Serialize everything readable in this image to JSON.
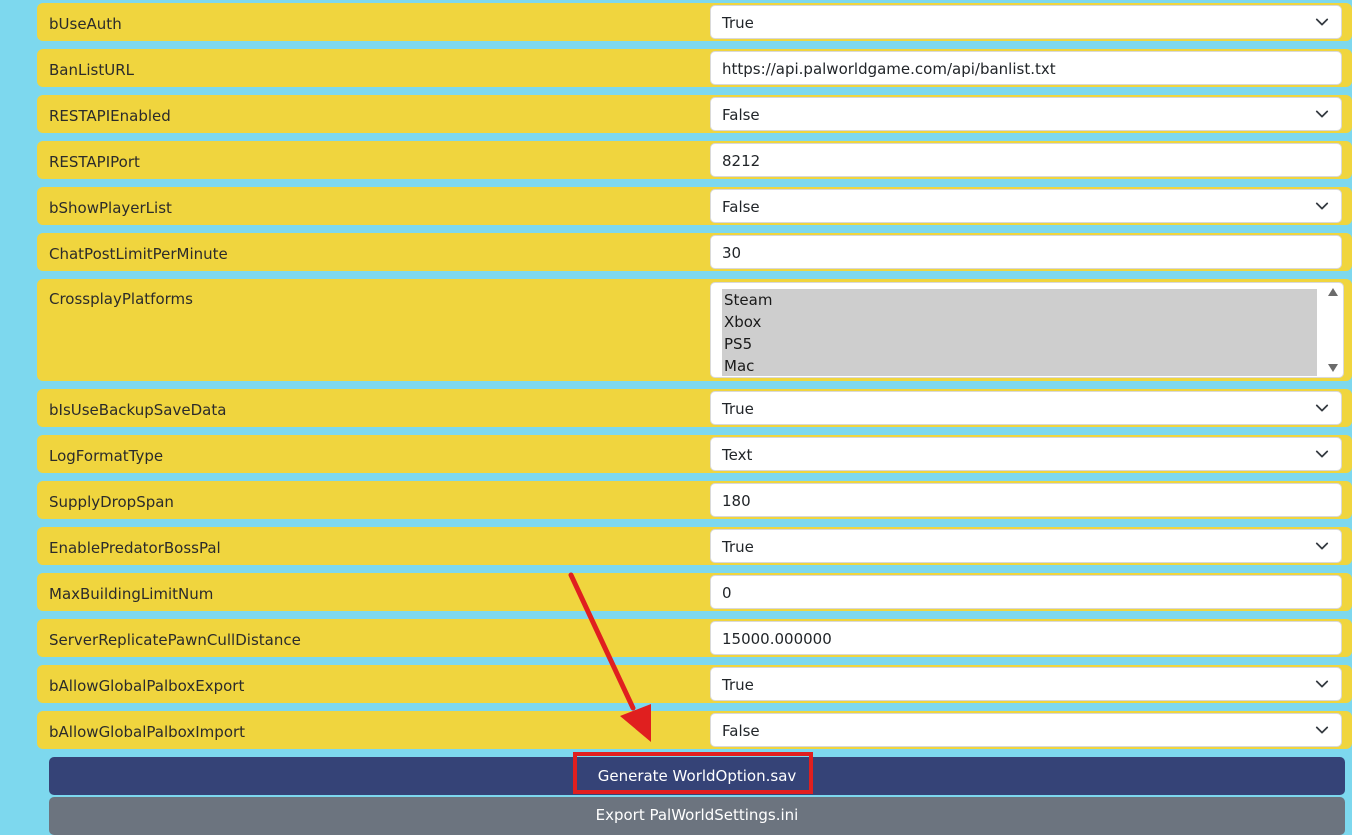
{
  "settings": [
    {
      "label": "bUseAuth",
      "value": "True",
      "type": "select"
    },
    {
      "label": "BanListURL",
      "value": "https://api.palworldgame.com/api/banlist.txt",
      "type": "text"
    },
    {
      "label": "RESTAPIEnabled",
      "value": "False",
      "type": "select"
    },
    {
      "label": "RESTAPIPort",
      "value": "8212",
      "type": "text"
    },
    {
      "label": "bShowPlayerList",
      "value": "False",
      "type": "select"
    },
    {
      "label": "ChatPostLimitPerMinute",
      "value": "30",
      "type": "text"
    },
    {
      "label": "CrossplayPlatforms",
      "type": "multiselect",
      "options": [
        "Steam",
        "Xbox",
        "PS5",
        "Mac"
      ]
    },
    {
      "label": "bIsUseBackupSaveData",
      "value": "True",
      "type": "select"
    },
    {
      "label": "LogFormatType",
      "value": "Text",
      "type": "select"
    },
    {
      "label": "SupplyDropSpan",
      "value": "180",
      "type": "text"
    },
    {
      "label": "EnablePredatorBossPal",
      "value": "True",
      "type": "select"
    },
    {
      "label": "MaxBuildingLimitNum",
      "value": "0",
      "type": "text"
    },
    {
      "label": "ServerReplicatePawnCullDistance",
      "value": "15000.000000",
      "type": "text"
    },
    {
      "label": "bAllowGlobalPalboxExport",
      "value": "True",
      "type": "select"
    },
    {
      "label": "bAllowGlobalPalboxImport",
      "value": "False",
      "type": "select"
    }
  ],
  "buttons": {
    "generate": "Generate WorldOption.sav",
    "export": "Export PalWorldSettings.ini"
  },
  "icons": {
    "select": "chevron-down-icon",
    "annotation": "red-arrow-icon"
  },
  "colors": {
    "background": "#7dd8ee",
    "row": "#f0d53e",
    "generate_button": "#354377",
    "export_button": "#6c747f",
    "annotation": "#e01f1f"
  }
}
